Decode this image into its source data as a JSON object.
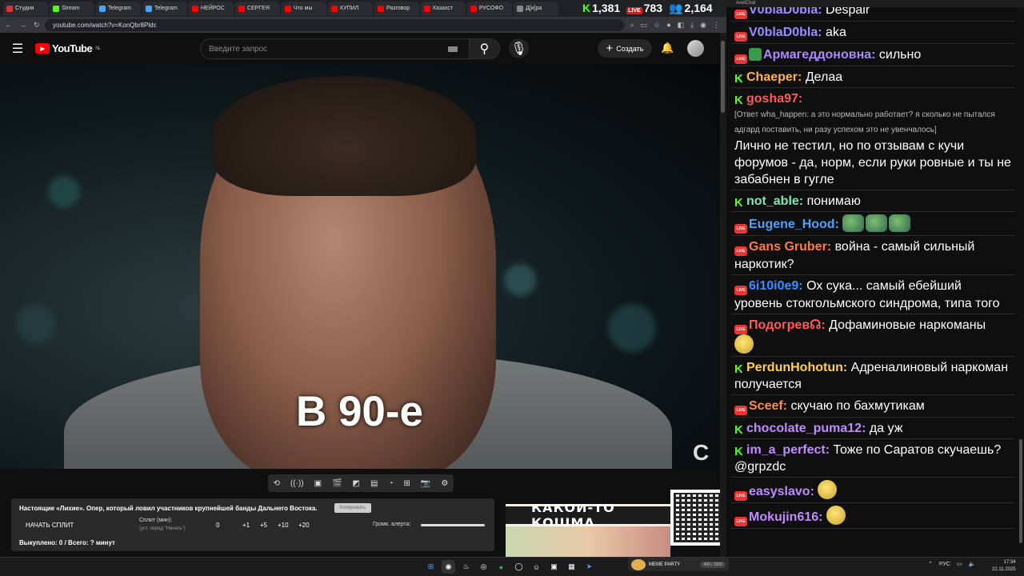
{
  "browser": {
    "tabs": [
      "Студия",
      "Stream",
      "Telegram",
      "Telegram",
      "НЕЙРОС",
      "СЕРГЕЯ",
      "Что мы",
      "КУПИЛ",
      "Разговор",
      "Казахст",
      "РУСОФО",
      "Д[и]ра"
    ],
    "url": "youtube.com/watch?v=KonQbr8Pldc"
  },
  "stats": {
    "kick_viewers": "1,381",
    "live_viewers": "783",
    "total_viewers": "2,164"
  },
  "youtube": {
    "logo_text": "YouTube",
    "logo_region": "NL",
    "search_placeholder": "Введите запрос",
    "create_label": "Создать"
  },
  "video": {
    "caption": "В 90-е"
  },
  "panel": {
    "title": "Настоящие «Лихие». Опер, который ловил участников крупнейшей банды Дальнего Востока.",
    "copy_label": "Копировать",
    "start_label": "НАЧАТЬ СПЛИТ",
    "split_label": "Сплит (мин):",
    "split_hint": "(уст. перед \"Начать\")",
    "values": [
      "0",
      "+1",
      "+5",
      "+10",
      "+20"
    ],
    "volume_label": "Громк. алерта:",
    "bought": "Выкуплено: 0 / Всего: ? минут"
  },
  "thumbnail": {
    "banner": "КАКОЙ-ТО КОШМА"
  },
  "chat_app": {
    "title": "AxelChat"
  },
  "chat": [
    {
      "platform": "live",
      "user": "V0blaD0bla",
      "color": "#9b8cff",
      "text": "Despair"
    },
    {
      "platform": "live",
      "user": "V0blaD0bla",
      "color": "#9b8cff",
      "text": "aka"
    },
    {
      "platform": "live",
      "badge": "shield",
      "user": "Армагеддоновна",
      "color": "#a78bfa",
      "text": "сильно"
    },
    {
      "platform": "kick",
      "user": "Chaeper",
      "color": "#ffb347",
      "text": "Делаа"
    },
    {
      "platform": "kick",
      "user": "gosha97",
      "color": "#ff5a5a",
      "reply": "[Ответ wha_happen: а это нормально работает? я сколько не пытался адгард поставить, ни разу успехом это не увенчалось]",
      "text": "Лично не тестил, но по отзывам с кучи форумов - да, норм, если руки ровные и ты не забабнен в гугле"
    },
    {
      "platform": "kick",
      "user": "not_able",
      "color": "#7fe7b0",
      "text": "понимаю"
    },
    {
      "platform": "live",
      "user": "Eugene_Hood",
      "color": "#4aa3ff",
      "text": "",
      "emotes": 3
    },
    {
      "platform": "live",
      "user": "Gans Gruber",
      "color": "#ff7a45",
      "text": "война - самый сильный наркотик?"
    },
    {
      "platform": "live",
      "user": "6i10i0e9",
      "color": "#3a8dff",
      "text": "Ох сука... самый ебейший уровень стокгольмского синдрома, типа того"
    },
    {
      "platform": "live",
      "user": "Подогрев☊",
      "color": "#ff5a5a",
      "text": "Дофаминовые наркоманы",
      "emote_block": true
    },
    {
      "platform": "kick",
      "user": "PerdunHohotun",
      "color": "#ffcf4a",
      "text": "Адреналиновый наркоман получается"
    },
    {
      "platform": "live",
      "user": "Sceef",
      "color": "#ff8c42",
      "text": "скучаю по бахмутикам"
    },
    {
      "platform": "kick",
      "user": "chocolate_puma12",
      "color": "#c08bff",
      "text": "да уж"
    },
    {
      "platform": "kick",
      "user": "im_a_perfect",
      "color": "#c08bff",
      "text": "Тоже по Саратов скучаешь? @grpzdc"
    },
    {
      "platform": "live",
      "user": "easyslavo",
      "color": "#c08bff",
      "text": "",
      "emoji": true
    },
    {
      "platform": "live",
      "user": "Mokujin616",
      "color": "#c08bff",
      "text": "",
      "emoji": true
    }
  ],
  "taskbar": {
    "meme_label": "MEME PARTY",
    "meme_progress": "400 / 1500",
    "lang": "РУС",
    "time": "17:34",
    "date": "22.11.2025"
  }
}
